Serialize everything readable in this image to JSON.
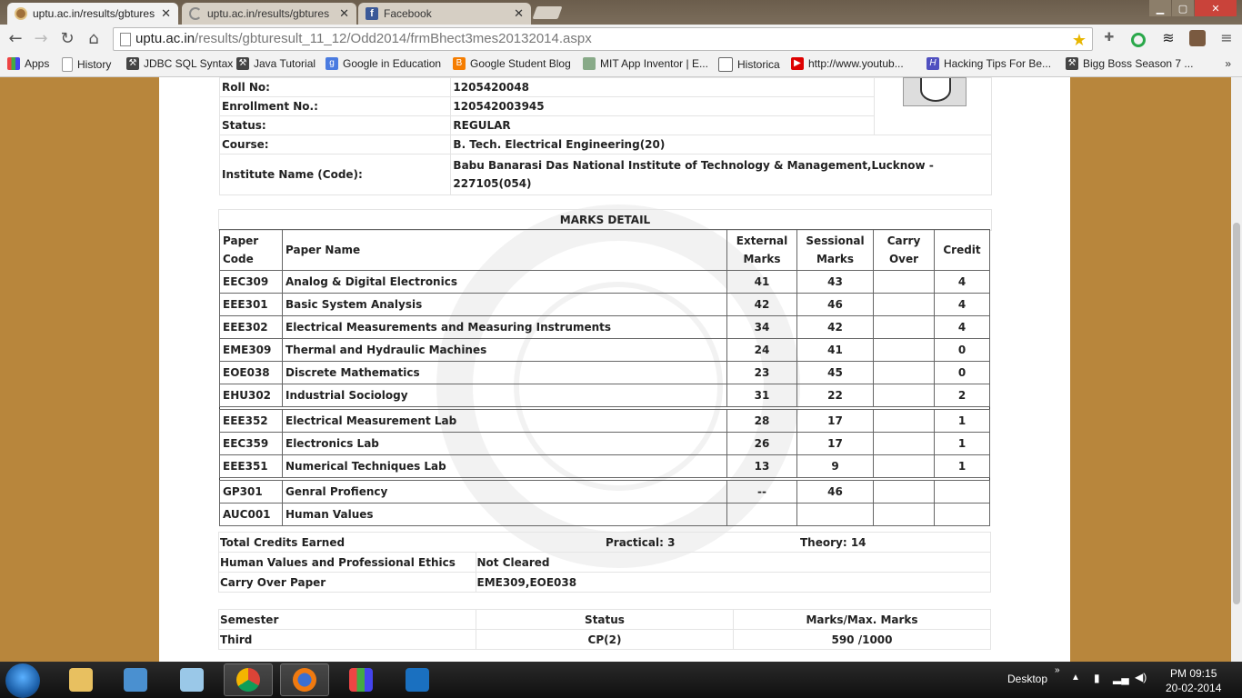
{
  "browser": {
    "tabs": [
      {
        "label": "uptu.ac.in/results/gbtures",
        "active": true
      },
      {
        "label": "uptu.ac.in/results/gbtures",
        "active": false
      },
      {
        "label": "Facebook",
        "active": false
      }
    ],
    "url_host": "uptu.ac.in",
    "url_path": "/results/gbturesult_11_12/Odd2014/frmBhect3mes20132014.aspx",
    "bookmarks": [
      "Apps",
      "History",
      "JDBC SQL Syntax",
      "Java Tutorial",
      "Google in Education",
      "Google Student Blog",
      "MIT App Inventor | E...",
      "Historica",
      "http://www.youtub...",
      "Hacking Tips For Be...",
      "Bigg Boss Season 7 ..."
    ],
    "bookmarks_more": "»"
  },
  "student": {
    "roll_label": "Roll No:",
    "roll_value": "1205420048",
    "enroll_label": "Enrollment No.:",
    "enroll_value": "120542003945",
    "status_label": "Status:",
    "status_value": "REGULAR",
    "course_label": "Course:",
    "course_value": "B. Tech. Electrical Engineering(20)",
    "institute_label": "Institute Name (Code):",
    "institute_value": "Babu Banarasi Das National Institute of Technology & Management,Lucknow - 227105(054)"
  },
  "marks": {
    "title": "MARKS DETAIL",
    "headers": [
      "Paper Code",
      "Paper Name",
      "External Marks",
      "Sessional Marks",
      "Carry Over",
      "Credit"
    ],
    "theory": [
      {
        "code": "EEC309",
        "name": "Analog & Digital Electronics",
        "ext": "41",
        "ses": "43",
        "carry": "",
        "credit": "4"
      },
      {
        "code": "EEE301",
        "name": "Basic System Analysis",
        "ext": "42",
        "ses": "46",
        "carry": "",
        "credit": "4"
      },
      {
        "code": "EEE302",
        "name": "Electrical Measurements and Measuring Instruments",
        "ext": "34",
        "ses": "42",
        "carry": "",
        "credit": "4"
      },
      {
        "code": "EME309",
        "name": "Thermal and Hydraulic Machines",
        "ext": "24",
        "ses": "41",
        "carry": "",
        "credit": "0"
      },
      {
        "code": "EOE038",
        "name": "Discrete Mathematics",
        "ext": "23",
        "ses": "45",
        "carry": "",
        "credit": "0"
      },
      {
        "code": "EHU302",
        "name": "Industrial Sociology",
        "ext": "31",
        "ses": "22",
        "carry": "",
        "credit": "2"
      }
    ],
    "practical": [
      {
        "code": "EEE352",
        "name": "Electrical Measurement  Lab",
        "ext": "28",
        "ses": "17",
        "carry": "",
        "credit": "1"
      },
      {
        "code": "EEC359",
        "name": "Electronics  Lab",
        "ext": "26",
        "ses": "17",
        "carry": "",
        "credit": "1"
      },
      {
        "code": "EEE351",
        "name": "Numerical Techniques  Lab",
        "ext": "13",
        "ses": "9",
        "carry": "",
        "credit": "1"
      }
    ],
    "other": [
      {
        "code": "GP301",
        "name": "Genral Profiency",
        "ext": "--",
        "ses": "46",
        "carry": "",
        "credit": ""
      },
      {
        "code": "AUC001",
        "name": "Human Values",
        "ext": "",
        "ses": "",
        "carry": "",
        "credit": ""
      }
    ]
  },
  "summary": {
    "credits_label": "Total Credits Earned",
    "practical_text": "Practical: 3",
    "theory_text": "Theory: 14",
    "hv_label": "Human Values and Professional Ethics",
    "hv_value": "Not Cleared",
    "carry_label": "Carry Over Paper",
    "carry_value": "EME309,EOE038"
  },
  "semester": {
    "headers": [
      "Semester",
      "Status",
      "Marks/Max. Marks"
    ],
    "row": [
      "Third",
      "CP(2)",
      "590 /1000"
    ]
  },
  "taskbar": {
    "desktop_label": "Desktop",
    "time": "PM 09:15",
    "date": "20-02-2014"
  }
}
